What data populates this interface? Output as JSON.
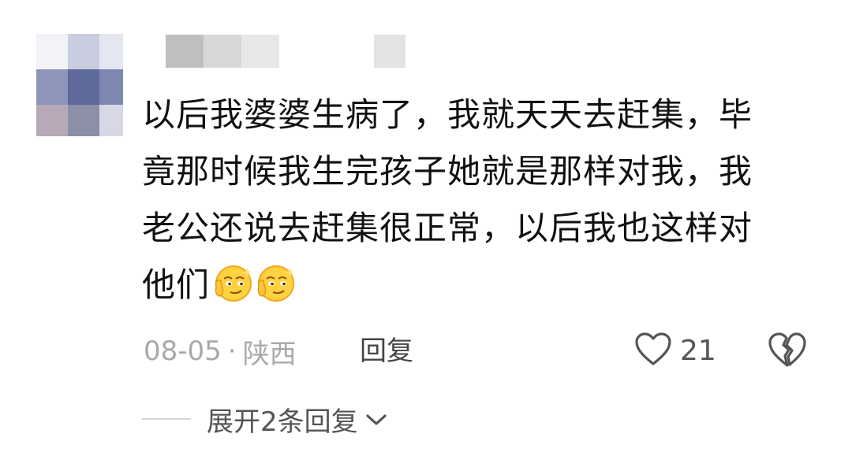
{
  "comment": {
    "text_lines": [
      "以后我婆婆生病了，我就天天去赶集，毕",
      "竟那时候我生完孩子她就是那样对我，我",
      "老公还说去赶集很正常，以后我也这样对"
    ],
    "last_line_text": "他们",
    "emojis": [
      "smirk-emoji",
      "smirk-emoji"
    ]
  },
  "meta": {
    "date": "08-05",
    "separator": "·",
    "location": "陕西",
    "reply_label": "回复"
  },
  "like": {
    "icon": "heart-outline-icon",
    "count": "21"
  },
  "dislike": {
    "icon": "broken-heart-icon"
  },
  "expand": {
    "label": "展开2条回复",
    "icon": "chevron-down-icon"
  },
  "colors": {
    "text_primary": "#111111",
    "text_meta": "#a9a9a9",
    "text_secondary": "#555555",
    "background": "#ffffff"
  }
}
